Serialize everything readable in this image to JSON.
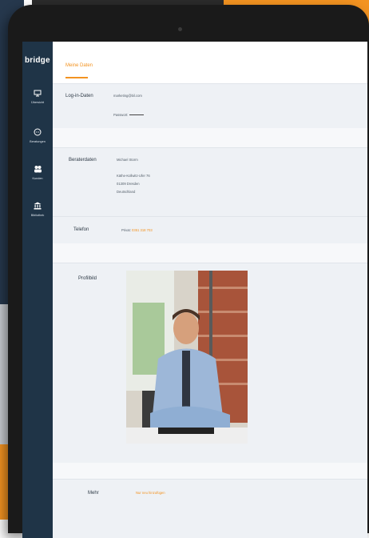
{
  "sidebar": {
    "logo": "bridge",
    "items": [
      {
        "label": "Übersicht",
        "icon": "monitor-icon"
      },
      {
        "label": "Beratungen",
        "icon": "chat-icon"
      },
      {
        "label": "Kunden",
        "icon": "users-icon"
      },
      {
        "label": "Bibliothek",
        "icon": "library-icon"
      }
    ]
  },
  "header": {
    "tab": "Meine Daten"
  },
  "login": {
    "label": "Log-in-Daten",
    "email": "marketing@bil.com",
    "password_label": "Passwort:"
  },
  "advisor": {
    "label": "Beraterdaten",
    "name": "Michael Storm",
    "street": "Käthe-Kollwitz-Ufer 76",
    "city": "01309 Dresden",
    "country": "Deutschland"
  },
  "phone": {
    "label": "Telefon",
    "prefix": "Privat:",
    "number": "0351 318 703"
  },
  "profile": {
    "label": "Profilbild"
  },
  "more": {
    "label": "Mehr",
    "link": "Nur neu hinzufügen"
  },
  "colors": {
    "accent": "#f39321",
    "sidebar": "#1f3447"
  }
}
